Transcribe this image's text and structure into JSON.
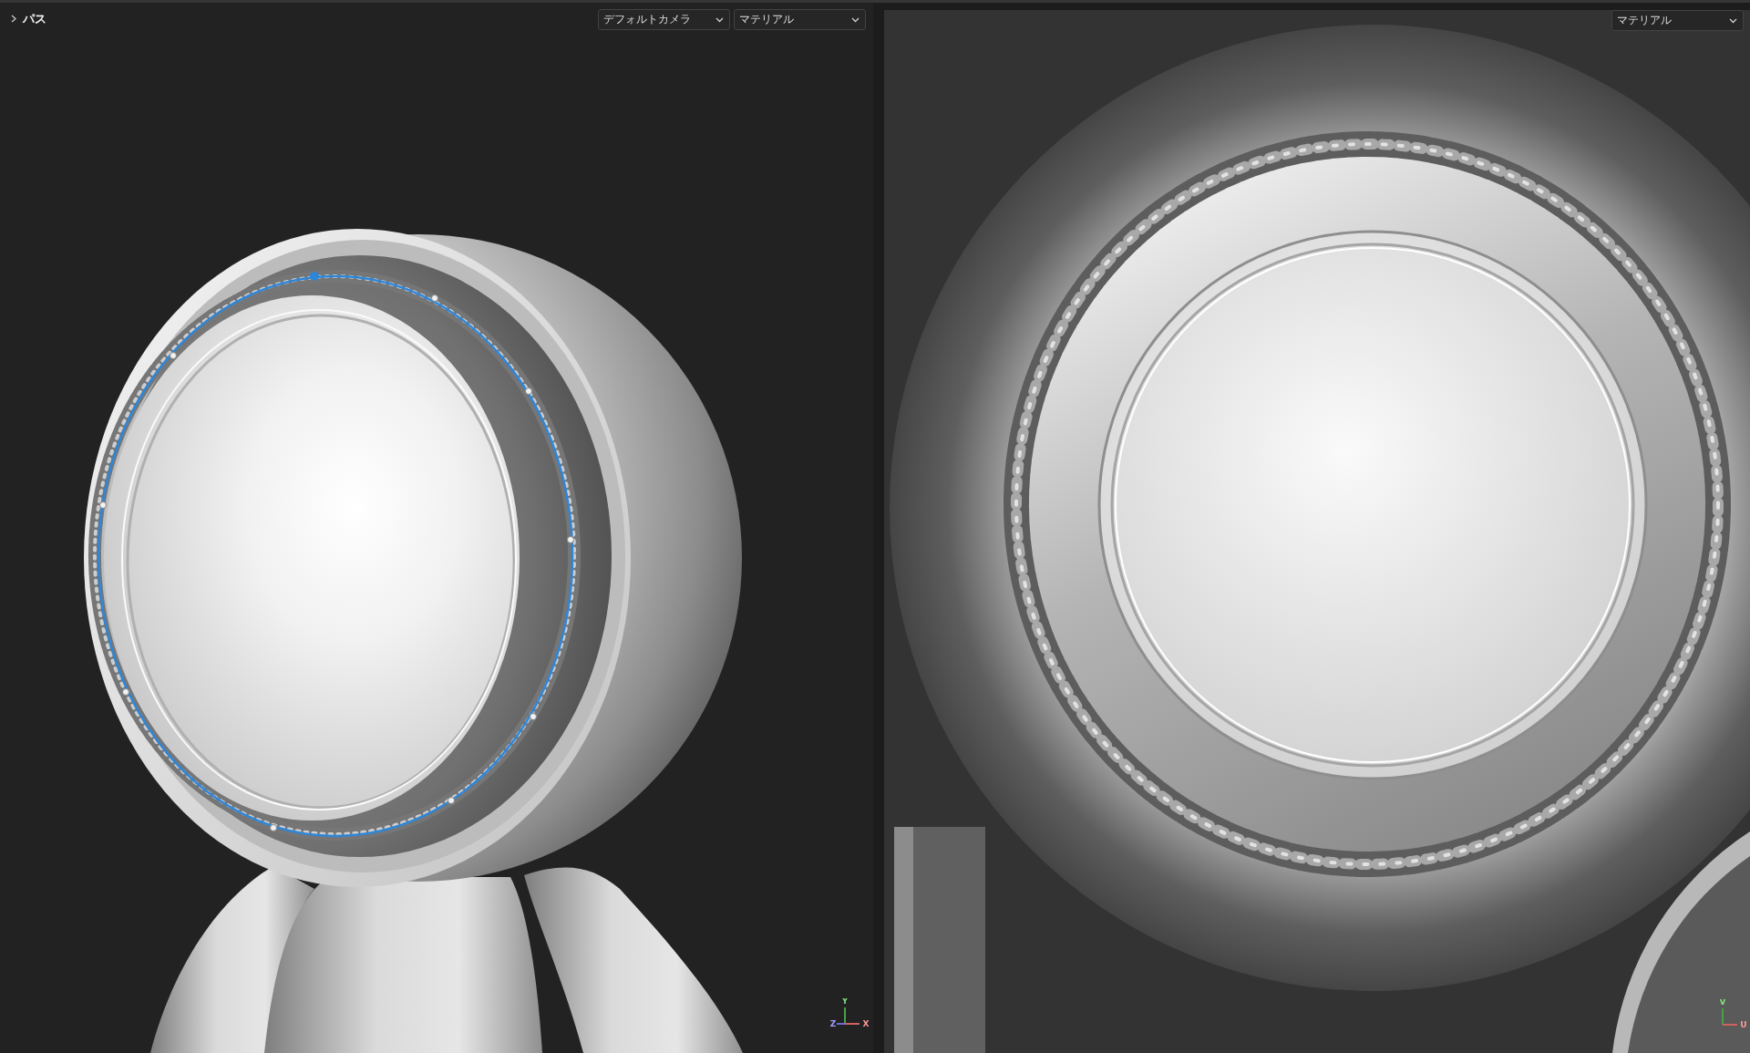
{
  "viewports": [
    {
      "kind": "scene",
      "outliner": {
        "label": "パス",
        "expanded": false
      },
      "dropdowns": [
        {
          "value": "デフォルトカメラ"
        },
        {
          "value": "マテリアル"
        }
      ],
      "axis_gizmo": {
        "axes": [
          {
            "kind": "vertical",
            "label": "Y"
          },
          {
            "kind": "depth",
            "label": "Z"
          },
          {
            "kind": "horizontal",
            "label": "X"
          }
        ]
      }
    },
    {
      "kind": "texture",
      "dropdowns": [
        {
          "value": "マテリアル"
        }
      ],
      "axis_gizmo": {
        "axes": [
          {
            "kind": "vertical",
            "label": "V"
          },
          {
            "kind": "horizontal",
            "label": "U"
          }
        ]
      }
    }
  ]
}
